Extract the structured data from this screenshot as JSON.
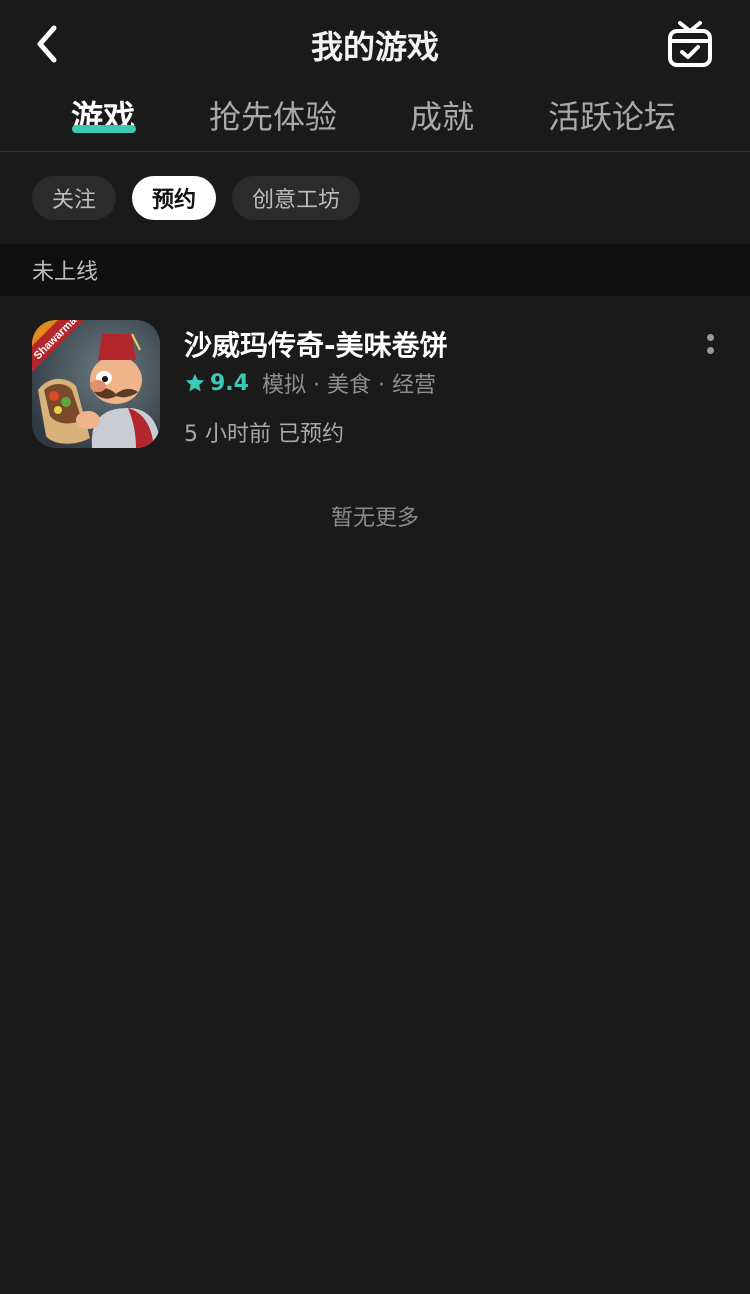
{
  "header": {
    "title": "我的游戏",
    "back_icon": "chevron-left-icon",
    "action_icon": "gift-check-icon"
  },
  "tabs": [
    {
      "label": "游戏",
      "active": true
    },
    {
      "label": "抢先体验",
      "active": false
    },
    {
      "label": "成就",
      "active": false
    },
    {
      "label": "活跃论坛",
      "active": false
    }
  ],
  "filters": [
    {
      "label": "关注",
      "active": false
    },
    {
      "label": "预约",
      "active": true
    },
    {
      "label": "创意工坊",
      "active": false
    }
  ],
  "section": {
    "title": "未上线"
  },
  "games": [
    {
      "title": "沙威玛传奇-美味卷饼",
      "rating": "9.4",
      "genres": "模拟 · 美食 · 经营",
      "status": "5 小时前 已预约",
      "icon_banner_text": "Shawarma"
    }
  ],
  "empty_note": "暂无更多",
  "colors": {
    "background": "#1a1a1a",
    "accent": "#3cc9b8",
    "section_bg": "#0f0f0f"
  }
}
